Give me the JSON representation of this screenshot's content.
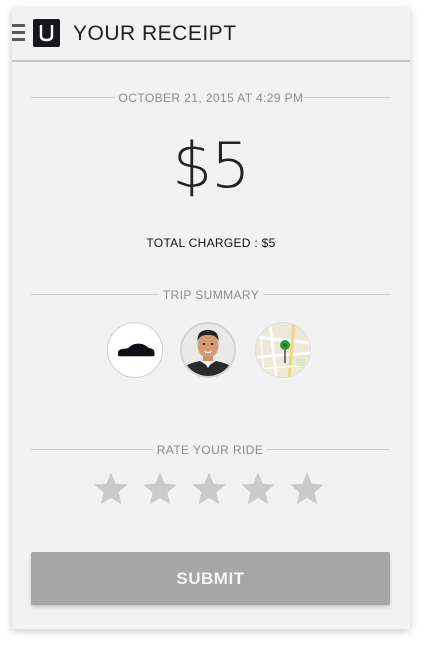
{
  "header": {
    "title": "YOUR RECEIPT",
    "menu_icon": "hamburger-menu-icon",
    "logo_icon": "uber-logo-icon"
  },
  "receipt": {
    "date": "OCTOBER 21, 2015 AT 4:29 PM",
    "amount": "$5",
    "total_label": "TOTAL CHARGED : $5"
  },
  "trip_summary": {
    "heading": "TRIP SUMMARY",
    "items": [
      {
        "icon": "car-icon"
      },
      {
        "icon": "driver-photo"
      },
      {
        "icon": "map-pin-icon"
      }
    ]
  },
  "rating": {
    "heading": "RATE YOUR RIDE",
    "max_stars": 5,
    "selected": 0,
    "star_color": "#cacaca"
  },
  "submit": {
    "label": "SUBMIT"
  },
  "colors": {
    "background": "#f2f2f2",
    "submit_bg": "#a7a7a7",
    "logo_bg": "#15171c",
    "map_pin": "#2e9b3a"
  }
}
